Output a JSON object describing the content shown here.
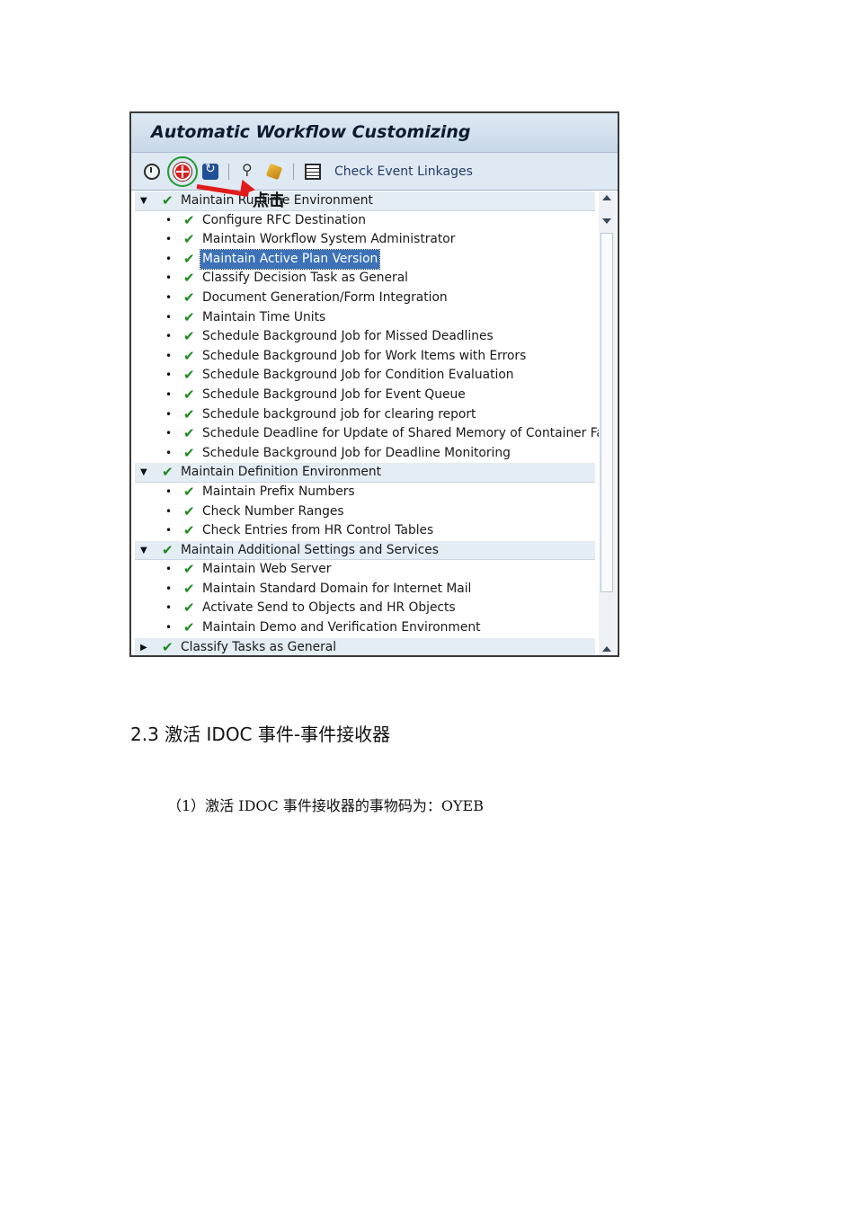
{
  "screenshot": {
    "title": "Automatic Workflow Customizing",
    "toolbar": {
      "check_event_linkages_label": "Check Event Linkages"
    },
    "tree": [
      {
        "type": "group",
        "expanded": true,
        "label": "Maintain Runtime Environment"
      },
      {
        "type": "item",
        "label": "Configure RFC Destination"
      },
      {
        "type": "item",
        "label": "Maintain Workflow System Administrator"
      },
      {
        "type": "item",
        "label": "Maintain Active Plan Version",
        "selected": true
      },
      {
        "type": "item",
        "label": "Classify Decision Task as General"
      },
      {
        "type": "item",
        "label": "Document Generation/Form Integration"
      },
      {
        "type": "item",
        "label": "Maintain Time Units"
      },
      {
        "type": "item",
        "label": "Schedule Background Job for Missed Deadlines"
      },
      {
        "type": "item",
        "label": "Schedule Background Job for Work Items with Errors"
      },
      {
        "type": "item",
        "label": "Schedule Background Job for Condition Evaluation"
      },
      {
        "type": "item",
        "label": "Schedule Background Job for Event Queue"
      },
      {
        "type": "item",
        "label": "Schedule background job for clearing report"
      },
      {
        "type": "item",
        "label": "Schedule Deadline for Update of Shared Memory of Container Fact"
      },
      {
        "type": "item",
        "label": "Schedule Background Job for Deadline Monitoring"
      },
      {
        "type": "group",
        "expanded": true,
        "label": "Maintain Definition Environment"
      },
      {
        "type": "item",
        "label": "Maintain Prefix Numbers"
      },
      {
        "type": "item",
        "label": "Check Number Ranges"
      },
      {
        "type": "item",
        "label": "Check Entries from HR Control Tables"
      },
      {
        "type": "group",
        "expanded": true,
        "label": "Maintain Additional Settings and Services"
      },
      {
        "type": "item",
        "label": "Maintain Web Server"
      },
      {
        "type": "item",
        "label": "Maintain Standard Domain for Internet Mail"
      },
      {
        "type": "item",
        "label": "Activate Send to Objects and HR Objects"
      },
      {
        "type": "item",
        "label": "Maintain Demo and Verification Environment"
      },
      {
        "type": "group",
        "expanded": false,
        "label": "Classify Tasks as General"
      }
    ],
    "annotation": "点击"
  },
  "document": {
    "heading": "2.3 激活 IDOC 事件-事件接收器",
    "paragraph": "（1）激活 IDOC 事件接收器的事物码为：OYEB"
  },
  "colors": {
    "check": "#1e8a1e",
    "selection": "#3d72b8",
    "annotation_arrow": "#e21b1b",
    "highlight_circle": "#1f9a33"
  }
}
